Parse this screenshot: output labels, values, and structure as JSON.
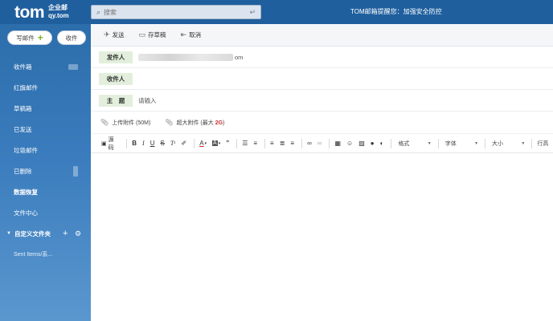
{
  "header": {
    "logo_main": "tom",
    "logo_sub1": "企业邮",
    "logo_sub2": "qy.tom",
    "search_placeholder": "搜索",
    "notice": "TOM邮箱提醒您：加强安全防控"
  },
  "sidebar": {
    "write_label": "写邮件",
    "receive_label": "收件",
    "folders": [
      {
        "label": "收件箱"
      },
      {
        "label": "红旗邮件"
      },
      {
        "label": "草稿箱"
      },
      {
        "label": "已发送"
      },
      {
        "label": "垃圾邮件"
      },
      {
        "label": "已删除"
      },
      {
        "label": "数据恢复"
      },
      {
        "label": "文件中心"
      }
    ],
    "custom_folder_label": "自定义文件夹",
    "sub_folder": "Sent Items/系..."
  },
  "toolbar": {
    "send": "发送",
    "save_draft": "存草稿",
    "cancel": "取消"
  },
  "compose": {
    "from_label": "发件人",
    "from_value_suffix": "om",
    "to_label": "收件人",
    "subject_label": "主　题",
    "subject_placeholder": "请输入"
  },
  "attachments": {
    "upload": "上传附件 (50M)",
    "large_prefix": "超大附件 (最大 ",
    "large_size": "2G",
    "large_suffix": ")"
  },
  "editor": {
    "source": "源码",
    "format": "格式",
    "font": "字体",
    "size": "大小",
    "line_height": "行高"
  }
}
